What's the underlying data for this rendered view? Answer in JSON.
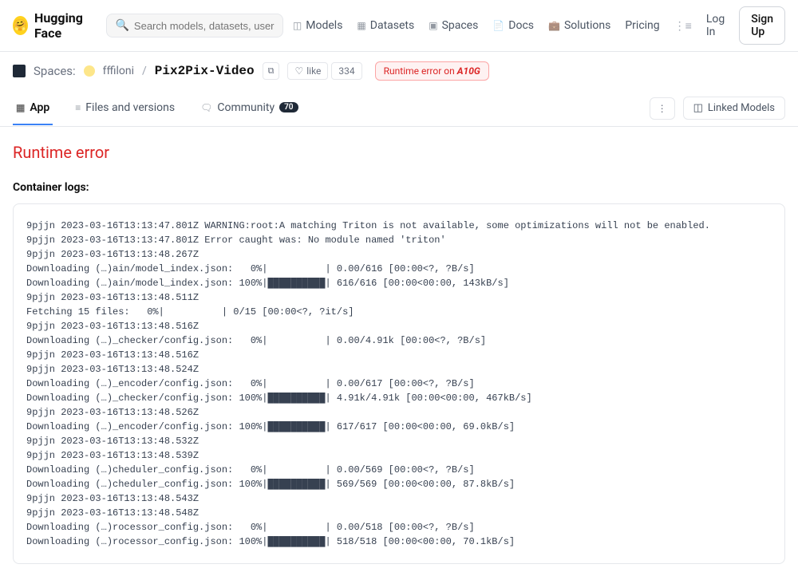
{
  "header": {
    "brand": "Hugging Face",
    "search_placeholder": "Search models, datasets, users...",
    "nav": {
      "models": "Models",
      "datasets": "Datasets",
      "spaces": "Spaces",
      "docs": "Docs",
      "solutions": "Solutions",
      "pricing": "Pricing"
    },
    "login": "Log In",
    "signup": "Sign Up"
  },
  "breadcrumb": {
    "section": "Spaces:",
    "user": "fffiloni",
    "name": "Pix2Pix-Video",
    "like_label": "like",
    "like_count": "334",
    "status_prefix": "Runtime error on ",
    "status_hw": "A10G"
  },
  "tabs": {
    "app": "App",
    "files": "Files and versions",
    "community": "Community",
    "community_count": "70",
    "linked": "Linked Models"
  },
  "content": {
    "error_title": "Runtime error",
    "logs_label": "Container logs:",
    "logs": "9pjjn 2023-03-16T13:13:47.801Z WARNING:root:A matching Triton is not available, some optimizations will not be enabled.\n9pjjn 2023-03-16T13:13:47.801Z Error caught was: No module named 'triton'\n9pjjn 2023-03-16T13:13:48.267Z\nDownloading (…)ain/model_index.json:   0%|          | 0.00/616 [00:00<?, ?B/s]\nDownloading (…)ain/model_index.json: 100%|██████████| 616/616 [00:00<00:00, 143kB/s]\n9pjjn 2023-03-16T13:13:48.511Z\nFetching 15 files:   0%|          | 0/15 [00:00<?, ?it/s]\n9pjjn 2023-03-16T13:13:48.516Z\nDownloading (…)_checker/config.json:   0%|          | 0.00/4.91k [00:00<?, ?B/s]\n9pjjn 2023-03-16T13:13:48.516Z\n9pjjn 2023-03-16T13:13:48.524Z\nDownloading (…)_encoder/config.json:   0%|          | 0.00/617 [00:00<?, ?B/s]\nDownloading (…)_checker/config.json: 100%|██████████| 4.91k/4.91k [00:00<00:00, 467kB/s]\n9pjjn 2023-03-16T13:13:48.526Z\nDownloading (…)_encoder/config.json: 100%|██████████| 617/617 [00:00<00:00, 69.0kB/s]\n9pjjn 2023-03-16T13:13:48.532Z\n9pjjn 2023-03-16T13:13:48.539Z\nDownloading (…)cheduler_config.json:   0%|          | 0.00/569 [00:00<?, ?B/s]\nDownloading (…)cheduler_config.json: 100%|██████████| 569/569 [00:00<00:00, 87.8kB/s]\n9pjjn 2023-03-16T13:13:48.543Z\n9pjjn 2023-03-16T13:13:48.548Z\nDownloading (…)rocessor_config.json:   0%|          | 0.00/518 [00:00<?, ?B/s]\nDownloading (…)rocessor_config.json: 100%|██████████| 518/518 [00:00<00:00, 70.1kB/s]"
  }
}
